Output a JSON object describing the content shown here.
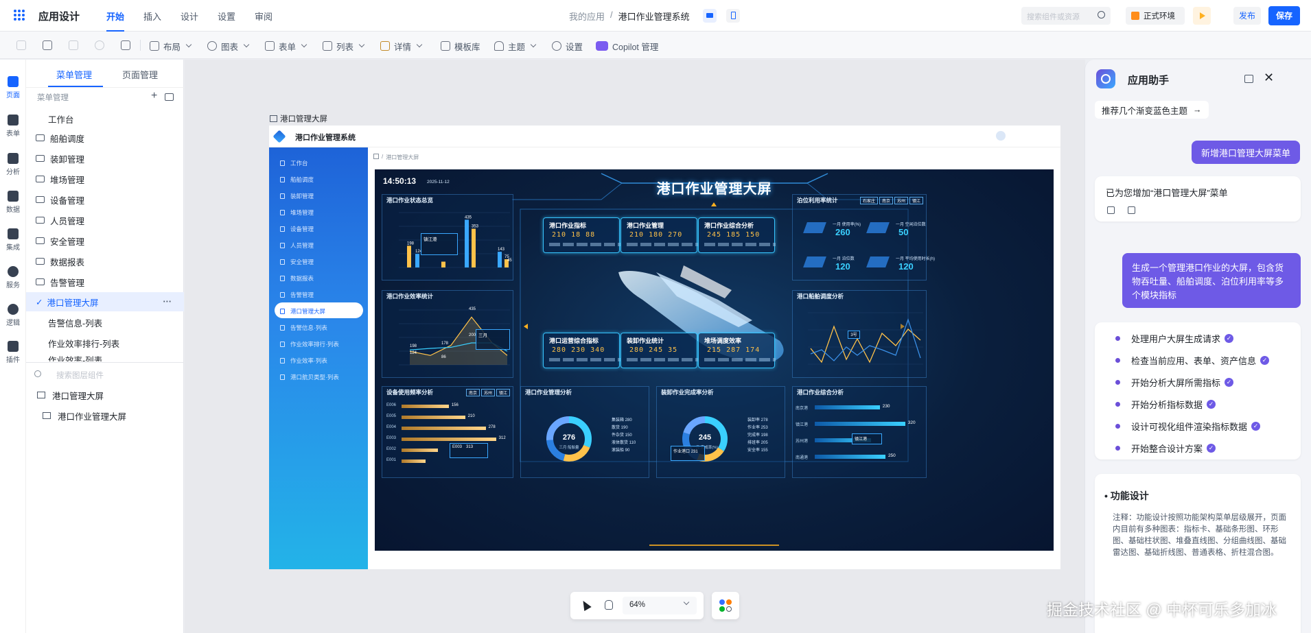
{
  "topbar": {
    "app_title": "应用设计",
    "tabs": [
      "开始",
      "插入",
      "设计",
      "设置",
      "审阅"
    ],
    "breadcrumb_root": "我的应用",
    "breadcrumb_sep": "/",
    "breadcrumb_current": "港口作业管理系统",
    "search_placeholder": "搜索组件或资源",
    "env_label": "正式环境",
    "publish_label": "发布",
    "save_label": "保存"
  },
  "toolbar": {
    "items": [
      "布局",
      "图表",
      "表单",
      "列表",
      "详情",
      "模板库",
      "主题",
      "设置",
      "Copilot 管理"
    ]
  },
  "rail": {
    "items": [
      "页面",
      "表单",
      "分析",
      "数据",
      "集成",
      "服务",
      "逻辑",
      "插件"
    ]
  },
  "panel": {
    "tabs": [
      "菜单管理",
      "页面管理"
    ],
    "section_label": "菜单管理",
    "menu": [
      "工作台",
      "船舶调度",
      "装卸管理",
      "堆场管理",
      "设备管理",
      "人员管理",
      "安全管理",
      "数据报表",
      "告警管理",
      "港口管理大屏",
      "告警信息-列表",
      "作业效率排行-列表",
      "作业效率-列表"
    ],
    "more": "···",
    "layer_search_placeholder": "搜索图层组件",
    "layers": [
      "港口管理大屏",
      "港口作业管理大屏"
    ]
  },
  "canvas": {
    "page_label": "港口管理大屏",
    "zoom": "64%"
  },
  "dashboard": {
    "system_title": "港口作业管理系统",
    "nav": [
      "工作台",
      "船舶调度",
      "装卸管理",
      "堆场管理",
      "设备管理",
      "人员管理",
      "安全管理",
      "数据报表",
      "告警管理",
      "港口管理大屏",
      "告警信息·列表",
      "作业效率排行·列表",
      "作业效率·列表",
      "港口航贝类型·列表"
    ],
    "breadcrumb": "港口管理大屏",
    "screen": {
      "time": "14:50:13",
      "date": "2025-11-12",
      "title": "港口作业管理大屏",
      "p1_title": "港口作业状态总览",
      "p2_title": "港口作业效率统计",
      "p3_title": "设备使用频率分析",
      "p4_title": "港口作业管理分析",
      "p5_title": "装卸作业完成率分析",
      "p6_title": "港口作业综合分析",
      "p7_title": "泊位利用率统计",
      "p8_title": "港口船舶调度分析",
      "city_tags": [
        "南京",
        "苏州",
        "镇江"
      ],
      "p7_tags": [
        "石家庄",
        "南京",
        "苏州",
        "镇江"
      ],
      "kpis": [
        {
          "title": "港口作业指标",
          "values": "210  18  88"
        },
        {
          "title": "港口作业管理",
          "values": "210 180 270"
        },
        {
          "title": "港口作业综合分析",
          "values": "245 185 150"
        },
        {
          "title": "港口运营综合指标",
          "values": "280 230 340"
        },
        {
          "title": "装卸作业统计",
          "values": "280 245  35"
        },
        {
          "title": "堆场调度效率",
          "values": "215 287 174"
        }
      ],
      "berth": [
        {
          "label": "一月 使用率(%)",
          "value": "260"
        },
        {
          "label": "一月 空闲泊位数",
          "value": "50"
        },
        {
          "label": "一月 泊位数",
          "value": "120"
        },
        {
          "label": "一月 平均使用时长(h)",
          "value": "120"
        }
      ],
      "bar_values": [
        "198",
        "124",
        "435",
        "353",
        "143",
        "75",
        "45"
      ],
      "tip1": "镇江港",
      "line_values": [
        "435",
        "198",
        "178",
        "200",
        "124",
        "86"
      ],
      "tip2": "三月",
      "hbars": [
        {
          "label": "E006",
          "value": "156"
        },
        {
          "label": "E005",
          "value": "210"
        },
        {
          "label": "E004",
          "value": "278"
        },
        {
          "label": "E003",
          "value": "312"
        },
        {
          "label": "E002",
          "value": "",
          "tip": "E003"
        },
        {
          "label": "E001",
          "value": "",
          "tip_val": "313"
        }
      ],
      "donut1": {
        "value": "276",
        "label": "三月 船舶量",
        "legend": [
          "集装箱 280",
          "散货 190",
          "件杂货 150",
          "液体散货 110",
          "滚装船 90"
        ]
      },
      "donut2": {
        "value": "245",
        "label": "一月 完成率(%)",
        "legend": [
          "装卸率 278",
          "作业率 253",
          "完成率 198",
          "排班率 205",
          "安全率 155"
        ],
        "tip": "作业港口",
        "tip_val": "231"
      },
      "ports": [
        {
          "label": "南京港",
          "value": "230"
        },
        {
          "label": "镇江港",
          "value": "320"
        },
        {
          "label": "苏州港",
          "value": ""
        },
        {
          "label": "南通港",
          "value": "250"
        }
      ],
      "tip3": "镇江港",
      "tip4": "3号"
    }
  },
  "assistant": {
    "title": "应用助手",
    "suggestion": "推荐几个渐变蓝色主题",
    "user_msg1": "新增港口管理大屏菜单",
    "bot_reply": "已为您增加“港口管理大屏”菜单",
    "user_msg2": "生成一个管理港口作业的大屏，包含货物吞吐量、船舶调度、泊位利用率等多个模块指标",
    "steps": [
      "处理用户大屏生成请求",
      "检查当前应用、表单、资产信息",
      "开始分析大屏所需指标",
      "开始分析指标数据",
      "设计可视化组件渲染指标数据",
      "开始整合设计方案"
    ],
    "section_title": "功能设计",
    "section_note": "注释：功能设计按照功能架构菜单层级展开，页面内目前有多种图表：指标卡、基础条形图、环形图、基础柱状图、堆叠直线图、分组曲线图、基础雷达图、基础折线图、普通表格、折柱混合图。"
  },
  "watermark": "掘金技术社区 @ 中杯可乐多加冰",
  "colors": {
    "primary": "#1664ff",
    "assistant_accent": "#6b4fd8",
    "screen_bg": "#0a1f3d",
    "kpi_value": "#ffc24a"
  }
}
